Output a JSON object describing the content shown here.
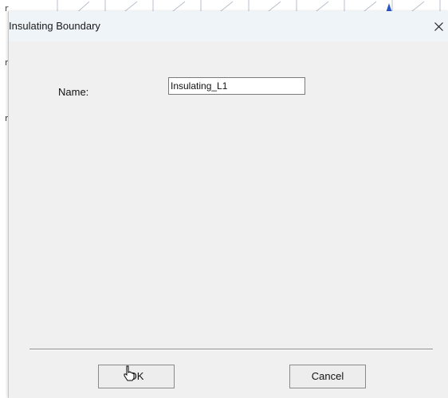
{
  "dialog": {
    "title": "Insulating Boundary",
    "close_symbol": "✕",
    "name_label": "Name:",
    "name_value": "Insulating_L1",
    "ok_label": "OK",
    "cancel_label": "Cancel"
  },
  "icons": {
    "close": "close-icon",
    "cursor": "hand-pointer-cursor-icon"
  },
  "colors": {
    "title_bar": "#eff4f9",
    "dialog_body": "#f0f0f0",
    "accent_triangle": "#2b56c8"
  }
}
